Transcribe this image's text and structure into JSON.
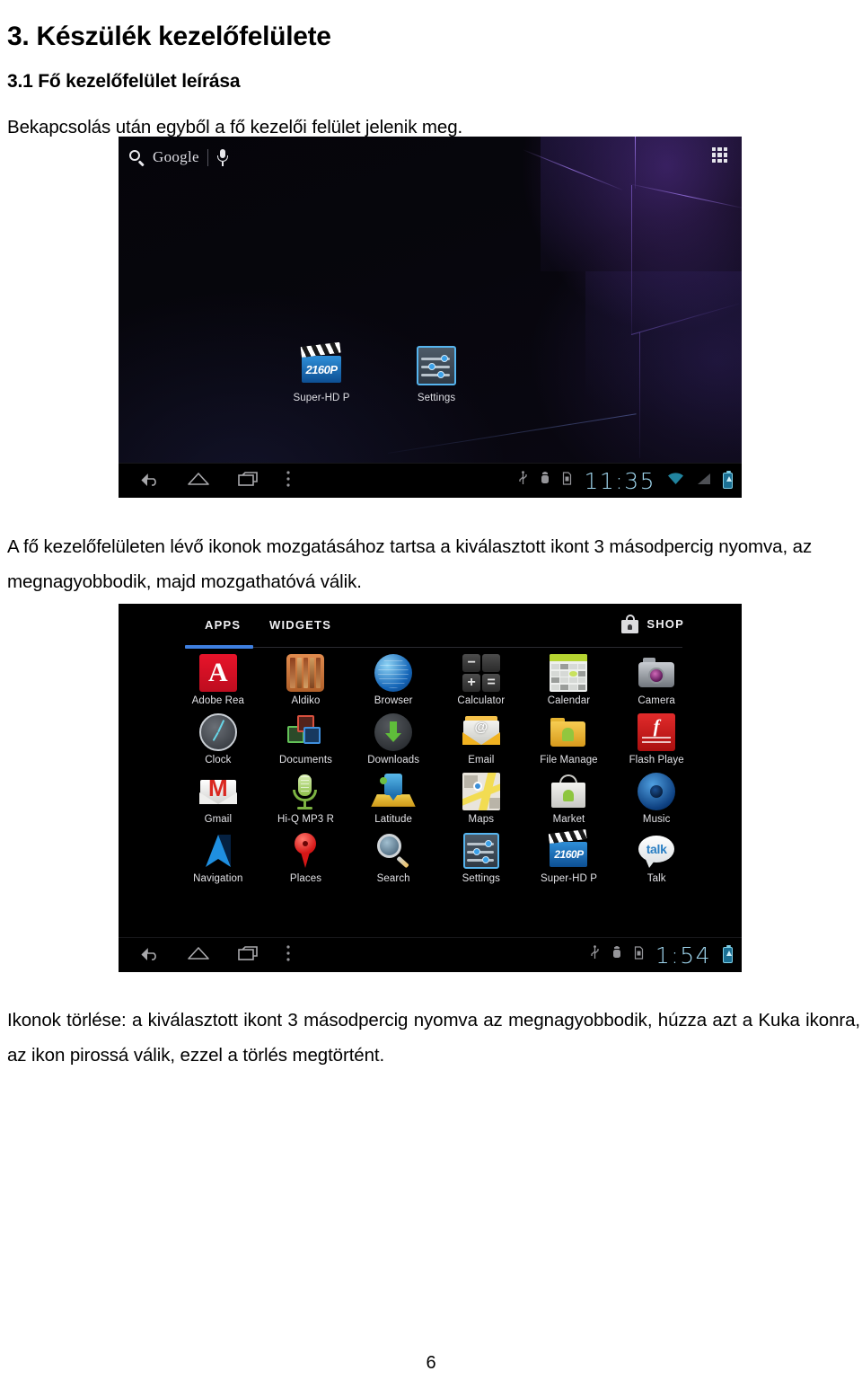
{
  "document": {
    "heading": "3. Készülék kezelőfelülete",
    "subheading": "3.1 Fő kezelőfelület leírása",
    "intro_paragraph": "Bekapcsolás után egyből a fő kezelői felület jelenik meg.",
    "middle_paragraph": "A fő kezelőfelületen lévő ikonok mozgatásához tartsa a kiválasztott ikont 3 másodpercig nyomva, az megnagyobbodik, majd mozgathatóvá válik.",
    "closing_paragraph": "Ikonok törlése: a kiválasztott ikont 3 másodpercig nyomva az megnagyobbodik, húzza azt a Kuka ikonra, az ikon pirossá válik, ezzel a törlés megtörtént.",
    "page_number": "6"
  },
  "home_screenshot": {
    "search_widget": {
      "icon": "search-icon",
      "label": "Google",
      "mic_icon": "microphone-icon"
    },
    "apps_button_icon": "apps-grid-icon",
    "icons": [
      {
        "label": "Super-HD P",
        "icon": "super-hd-player-icon",
        "badge": "2160P"
      },
      {
        "label": "Settings",
        "icon": "settings-sliders-icon"
      }
    ],
    "nav_bar": {
      "back_icon": "back-arrow-icon",
      "home_icon": "home-icon",
      "recents_icon": "recent-apps-icon",
      "menu_icon": "overflow-menu-icon",
      "status_icons": [
        "usb-icon",
        "android-debug-icon",
        "sd-card-icon"
      ],
      "clock": "11:35",
      "wifi_icon": "wifi-icon",
      "signal_icon": "signal-icon",
      "battery_icon": "battery-charging-icon"
    }
  },
  "drawer_screenshot": {
    "tabs": [
      {
        "label": "APPS",
        "selected": true
      },
      {
        "label": "WIDGETS",
        "selected": false
      }
    ],
    "shop": {
      "label": "SHOP",
      "icon": "shop-bag-icon"
    },
    "accent_color": "#3e7fe0",
    "apps": [
      {
        "label": "Adobe Rea",
        "icon": "adobe-reader-icon"
      },
      {
        "label": "Aldiko",
        "icon": "aldiko-icon"
      },
      {
        "label": "Browser",
        "icon": "browser-icon"
      },
      {
        "label": "Calculator",
        "icon": "calculator-icon"
      },
      {
        "label": "Calendar",
        "icon": "calendar-icon"
      },
      {
        "label": "Camera",
        "icon": "camera-icon"
      },
      {
        "label": "Clock",
        "icon": "clock-icon"
      },
      {
        "label": "Documents",
        "icon": "documents-icon"
      },
      {
        "label": "Downloads",
        "icon": "downloads-icon"
      },
      {
        "label": "Email",
        "icon": "email-icon"
      },
      {
        "label": "File Manage",
        "icon": "file-manager-icon"
      },
      {
        "label": "Flash Playe",
        "icon": "flash-player-icon"
      },
      {
        "label": "Gmail",
        "icon": "gmail-icon"
      },
      {
        "label": "Hi-Q MP3 R",
        "icon": "hi-q-mp3-recorder-icon"
      },
      {
        "label": "Latitude",
        "icon": "latitude-icon"
      },
      {
        "label": "Maps",
        "icon": "maps-icon"
      },
      {
        "label": "Market",
        "icon": "market-icon"
      },
      {
        "label": "Music",
        "icon": "music-icon"
      },
      {
        "label": "Navigation",
        "icon": "navigation-icon"
      },
      {
        "label": "Places",
        "icon": "places-icon"
      },
      {
        "label": "Search",
        "icon": "search-icon"
      },
      {
        "label": "Settings",
        "icon": "settings-sliders-icon"
      },
      {
        "label": "Super-HD P",
        "icon": "super-hd-player-icon"
      },
      {
        "label": "Talk",
        "icon": "talk-icon"
      }
    ],
    "nav_bar": {
      "back_icon": "back-arrow-icon",
      "home_icon": "home-icon",
      "recents_icon": "recent-apps-icon",
      "menu_icon": "overflow-menu-icon",
      "status_icons": [
        "usb-icon",
        "android-debug-icon",
        "sd-card-icon"
      ],
      "clock": "1:54",
      "battery_icon": "battery-charging-icon"
    }
  }
}
